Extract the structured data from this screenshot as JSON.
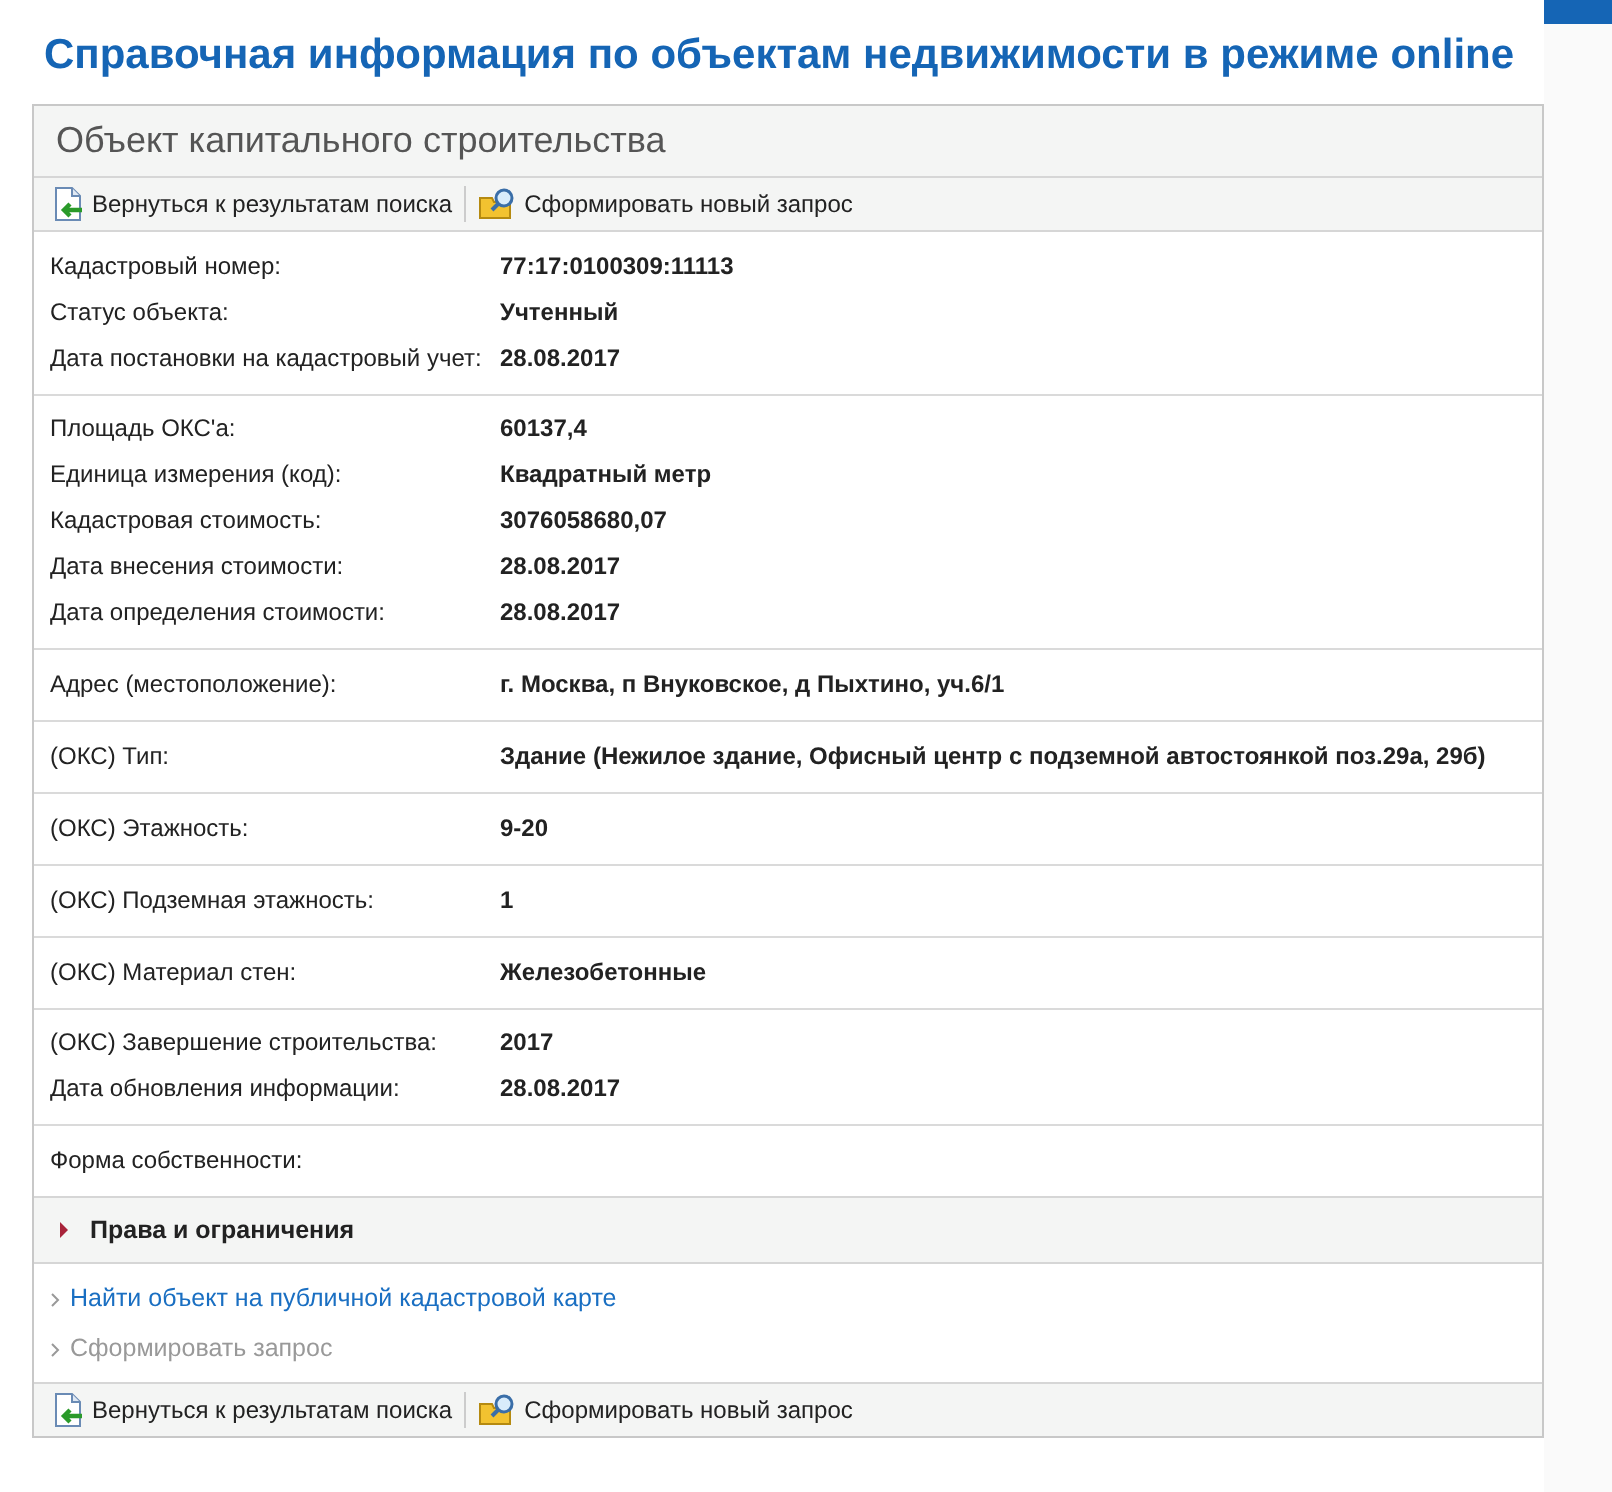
{
  "title": "Справочная информация по объектам недвижимости в режиме online",
  "panel": {
    "heading": "Объект капитального строительства"
  },
  "toolbar_top": [
    {
      "kind": "back",
      "label": "Вернуться к результатам поиска"
    },
    {
      "kind": "new",
      "label": "Сформировать новый запрос"
    }
  ],
  "groups": [
    [
      {
        "label": "Кадастровый номер:",
        "value": "77:17:0100309:11113"
      },
      {
        "label": "Статус объекта:",
        "value": "Учтенный"
      },
      {
        "label": "Дата постановки на кадастровый учет:",
        "value": "28.08.2017"
      }
    ],
    [
      {
        "label": "Площадь ОКС'а:",
        "value": "60137,4"
      },
      {
        "label": "Единица измерения (код):",
        "value": "Квадратный метр"
      },
      {
        "label": "Кадастровая стоимость:",
        "value": "3076058680,07"
      },
      {
        "label": "Дата внесения стоимости:",
        "value": "28.08.2017"
      },
      {
        "label": "Дата определения стоимости:",
        "value": "28.08.2017"
      }
    ],
    [
      {
        "label": "Адрес (местоположение):",
        "value": "г. Москва, п Внуковское, д Пыхтино, уч.6/1"
      }
    ],
    [
      {
        "label": "(ОКС) Тип:",
        "value": "Здание (Нежилое здание, Офисный центр с подземной автостоянкой поз.29а, 29б)"
      }
    ],
    [
      {
        "label": "(ОКС) Этажность:",
        "value": "9-20"
      }
    ],
    [
      {
        "label": "(ОКС) Подземная этажность:",
        "value": "1"
      }
    ],
    [
      {
        "label": "(ОКС) Материал стен:",
        "value": "Железобетонные"
      }
    ],
    [
      {
        "label": "(ОКС) Завершение строительства:",
        "value": "2017"
      },
      {
        "label": "Дата обновления информации:",
        "value": "28.08.2017"
      }
    ],
    [
      {
        "label": "Форма собственности:"
      }
    ]
  ],
  "section": {
    "label": "Права и ограничения",
    "expanded": false
  },
  "links": [
    {
      "label": "Найти объект на публичной кадастровой карте",
      "disabled": false
    },
    {
      "label": "Сформировать запрос",
      "disabled": true
    }
  ],
  "toolbar_bottom": [
    {
      "kind": "back",
      "label": "Вернуться к результатам поиска"
    },
    {
      "kind": "new",
      "label": "Сформировать новый запрос"
    }
  ]
}
